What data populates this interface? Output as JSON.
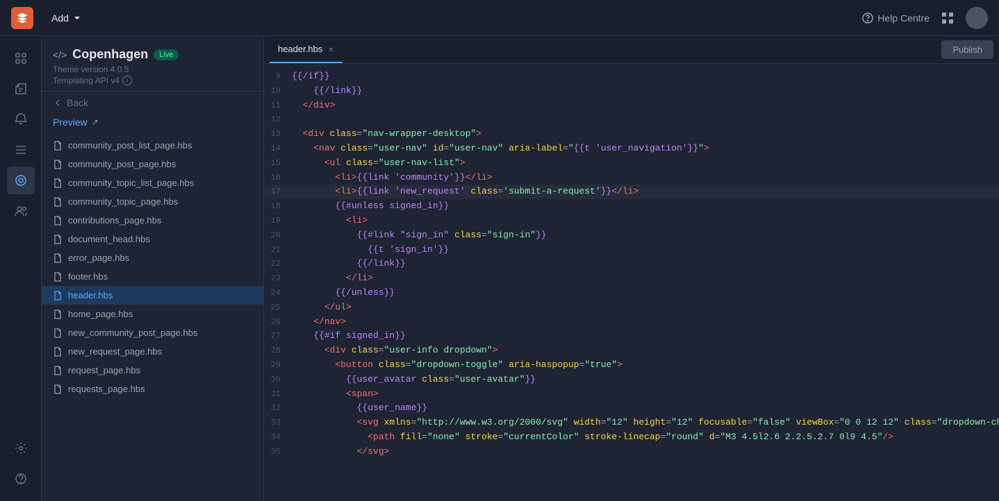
{
  "topbar": {
    "add_label": "Add",
    "help_label": "Help Centre"
  },
  "sidebar": {
    "theme_name": "Copenhagen",
    "live_badge": "Live",
    "version_label": "Theme version 4.0.5",
    "api_label": "Templating API v4",
    "back_label": "Back",
    "preview_label": "Preview"
  },
  "files": [
    {
      "name": "community_post_list_page.hbs",
      "type": "file"
    },
    {
      "name": "community_post_page.hbs",
      "type": "file"
    },
    {
      "name": "community_topic_list_page.hbs",
      "type": "file"
    },
    {
      "name": "community_topic_page.hbs",
      "type": "file"
    },
    {
      "name": "contributions_page.hbs",
      "type": "file"
    },
    {
      "name": "document_head.hbs",
      "type": "file"
    },
    {
      "name": "error_page.hbs",
      "type": "file"
    },
    {
      "name": "footer.hbs",
      "type": "file"
    },
    {
      "name": "header.hbs",
      "type": "file",
      "active": true
    },
    {
      "name": "home_page.hbs",
      "type": "file"
    },
    {
      "name": "new_community_post_page.hbs",
      "type": "file"
    },
    {
      "name": "new_request_page.hbs",
      "type": "file"
    },
    {
      "name": "request_page.hbs",
      "type": "file"
    },
    {
      "name": "requests_page.hbs",
      "type": "file"
    }
  ],
  "active_tab": "header.hbs",
  "publish_label": "Publish",
  "code_lines": [
    {
      "num": 9,
      "html": "<span class='hbs'>{{/if}}</span>"
    },
    {
      "num": 10,
      "html": "    <span class='hbs'>{{/link}}</span>"
    },
    {
      "num": 11,
      "html": "  <span class='tag'>&lt;/div&gt;</span>"
    },
    {
      "num": 12,
      "html": ""
    },
    {
      "num": 13,
      "html": "  <span class='tag'>&lt;div</span> <span class='attr'>class</span><span class='punct'>=</span><span class='val'>\"nav-wrapper-desktop\"</span><span class='tag'>&gt;</span>"
    },
    {
      "num": 14,
      "html": "    <span class='tag'>&lt;nav</span> <span class='attr'>class</span><span class='punct'>=</span><span class='val'>\"user-nav\"</span> <span class='attr'>id</span><span class='punct'>=</span><span class='val'>\"user-nav\"</span> <span class='attr'>aria-label</span><span class='punct'>=</span><span class='val'>\"</span><span class='hbs'>{{t 'user_navigation'}}</span><span class='val'>\"</span><span class='tag'>&gt;</span>"
    },
    {
      "num": 15,
      "html": "      <span class='tag'>&lt;ul</span> <span class='attr'>class</span><span class='punct'>=</span><span class='val'>\"user-nav-list\"</span><span class='tag'>&gt;</span>"
    },
    {
      "num": 16,
      "html": "        <span class='tag'>&lt;li&gt;</span><span class='hbs'>{{link 'community'}}</span><span class='tag'>&lt;/li&gt;</span>"
    },
    {
      "num": 17,
      "html": "        <span class='tag'>&lt;li&gt;</span><span class='hbs'>{{link 'new_request'</span> <span class='attr'>class</span><span class='punct'>=</span><span class='val'>'submit-a-request'</span><span class='hbs'>}}</span><span class='tag'>&lt;/li&gt;</span>"
    },
    {
      "num": 18,
      "html": "        <span class='hbs'>{{#unless signed_in}}</span>"
    },
    {
      "num": 19,
      "html": "          <span class='tag'>&lt;li&gt;</span>"
    },
    {
      "num": 20,
      "html": "            <span class='hbs'>{{#link \"sign_in\"</span> <span class='attr'>class</span><span class='punct'>=</span><span class='val'>\"sign-in\"</span><span class='hbs'>}}</span>"
    },
    {
      "num": 21,
      "html": "              <span class='hbs'>{{t 'sign_in'}}</span>"
    },
    {
      "num": 22,
      "html": "            <span class='hbs'>{{/link}}</span>"
    },
    {
      "num": 23,
      "html": "          <span class='tag'>&lt;/li&gt;</span>"
    },
    {
      "num": 24,
      "html": "        <span class='hbs'>{{/unless}}</span>"
    },
    {
      "num": 25,
      "html": "      <span class='tag'>&lt;/ul&gt;</span>"
    },
    {
      "num": 26,
      "html": "    <span class='tag'>&lt;/nav&gt;</span>"
    },
    {
      "num": 27,
      "html": "    <span class='hbs'>{{#if signed_in}}</span>"
    },
    {
      "num": 28,
      "html": "      <span class='tag'>&lt;div</span> <span class='attr'>class</span><span class='punct'>=</span><span class='val'>\"user-info dropdown\"</span><span class='tag'>&gt;</span>"
    },
    {
      "num": 29,
      "html": "        <span class='tag'>&lt;button</span> <span class='attr'>class</span><span class='punct'>=</span><span class='val'>\"dropdown-toggle\"</span> <span class='attr'>aria-haspopup</span><span class='punct'>=</span><span class='val'>\"true\"</span><span class='tag'>&gt;</span>"
    },
    {
      "num": 30,
      "html": "          <span class='hbs'>{{user_avatar</span> <span class='attr'>class</span><span class='punct'>=</span><span class='val'>\"user-avatar\"</span><span class='hbs'>}}</span>"
    },
    {
      "num": 31,
      "html": "          <span class='tag'>&lt;span&gt;</span>"
    },
    {
      "num": 32,
      "html": "            <span class='hbs'>{{user_name}}</span>"
    },
    {
      "num": 33,
      "html": "            <span class='tag'>&lt;svg</span> <span class='attr'>xmlns</span><span class='punct'>=</span><span class='val'>\"http://www.w3.org/2000/svg\"</span> <span class='attr'>width</span><span class='punct'>=</span><span class='val'>\"12\"</span> <span class='attr'>height</span><span class='punct'>=</span><span class='val'>\"12\"</span> <span class='attr'>focusable</span><span class='punct'>=</span><span class='val'>\"false\"</span> <span class='attr'>viewBox</span><span class='punct'>=</span><span class='val'>\"0 0 12 12\"</span> <span class='attr'>class</span><span class='punct'>=</span><span class='val'>\"dropdown-chevron-icon\"</span> <span class='attr'>aria-hidden</span><span class='punct'>=</span><span class='val'>\"true\"</span><span class='tag'>&gt;</span>"
    },
    {
      "num": 34,
      "html": "              <span class='tag'>&lt;path</span> <span class='attr'>fill</span><span class='punct'>=</span><span class='val'>\"none\"</span> <span class='attr'>stroke</span><span class='punct'>=</span><span class='val'>\"currentColor\"</span> <span class='attr'>stroke-linecap</span><span class='punct'>=</span><span class='val'>\"round\"</span> <span class='attr'>d</span><span class='punct'>=</span><span class='val'>\"M3 4.5l2.6 2.2.5.2.7 0l9 4.5\"</span><span class='tag'>/&gt;</span>"
    },
    {
      "num": 35,
      "html": "            <span class='tag'>&lt;/svg&gt;</span>"
    }
  ]
}
